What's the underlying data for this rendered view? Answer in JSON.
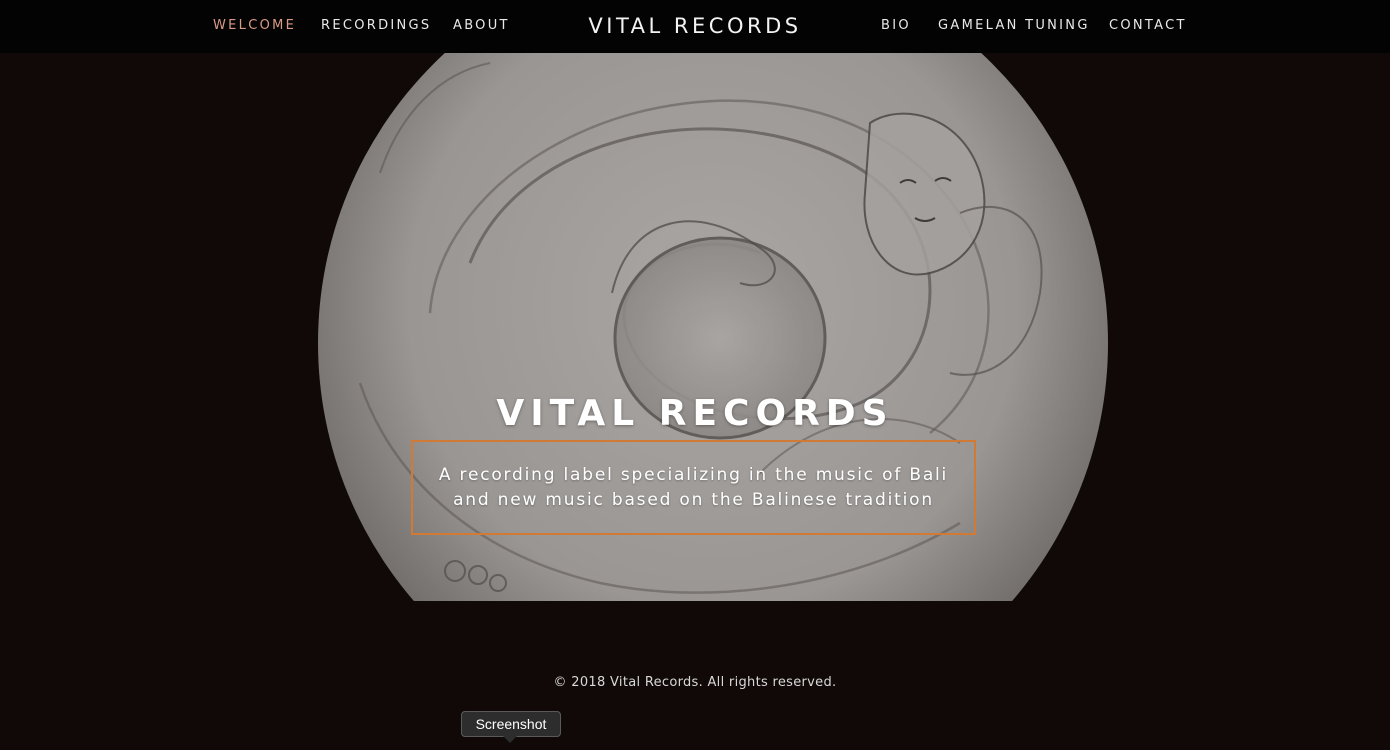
{
  "nav": {
    "left": [
      {
        "label": "WELCOME",
        "active": true
      },
      {
        "label": "RECORDINGS",
        "active": false
      },
      {
        "label": "ABOUT",
        "active": false
      }
    ],
    "brand": "VITAL RECORDS",
    "right": [
      {
        "label": "BIO"
      },
      {
        "label": "GAMELAN TUNING"
      },
      {
        "label": "CONTACT"
      }
    ]
  },
  "hero": {
    "image_icon": "balinese-drawing-image",
    "title": "VITAL RECORDS",
    "tagline_line1": "A recording label specializing in the music of Bali",
    "tagline_line2": "and new music based on the Balinese tradition"
  },
  "footer": {
    "copyright": "© 2018 Vital Records. All rights reserved."
  },
  "tooltip": {
    "label": "Screenshot"
  },
  "colors": {
    "nav_bg": "#030303",
    "page_bg": "#100908",
    "active_link": "#d99a86",
    "box_border": "#d07a35"
  }
}
